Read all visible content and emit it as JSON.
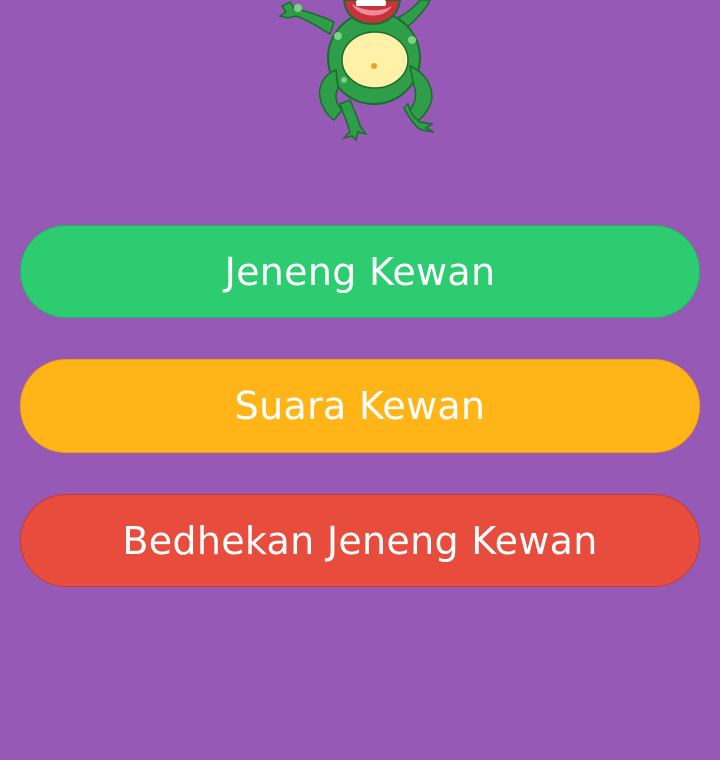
{
  "mascot": {
    "icon": "frog-icon"
  },
  "menu": {
    "items": [
      {
        "label": "Jeneng Kewan",
        "color": "#2ecc71"
      },
      {
        "label": "Suara Kewan",
        "color": "#ffb517"
      },
      {
        "label": "Bedhekan Jeneng Kewan",
        "color": "#e74c3c"
      }
    ]
  },
  "theme": {
    "background": "#9659b5"
  }
}
